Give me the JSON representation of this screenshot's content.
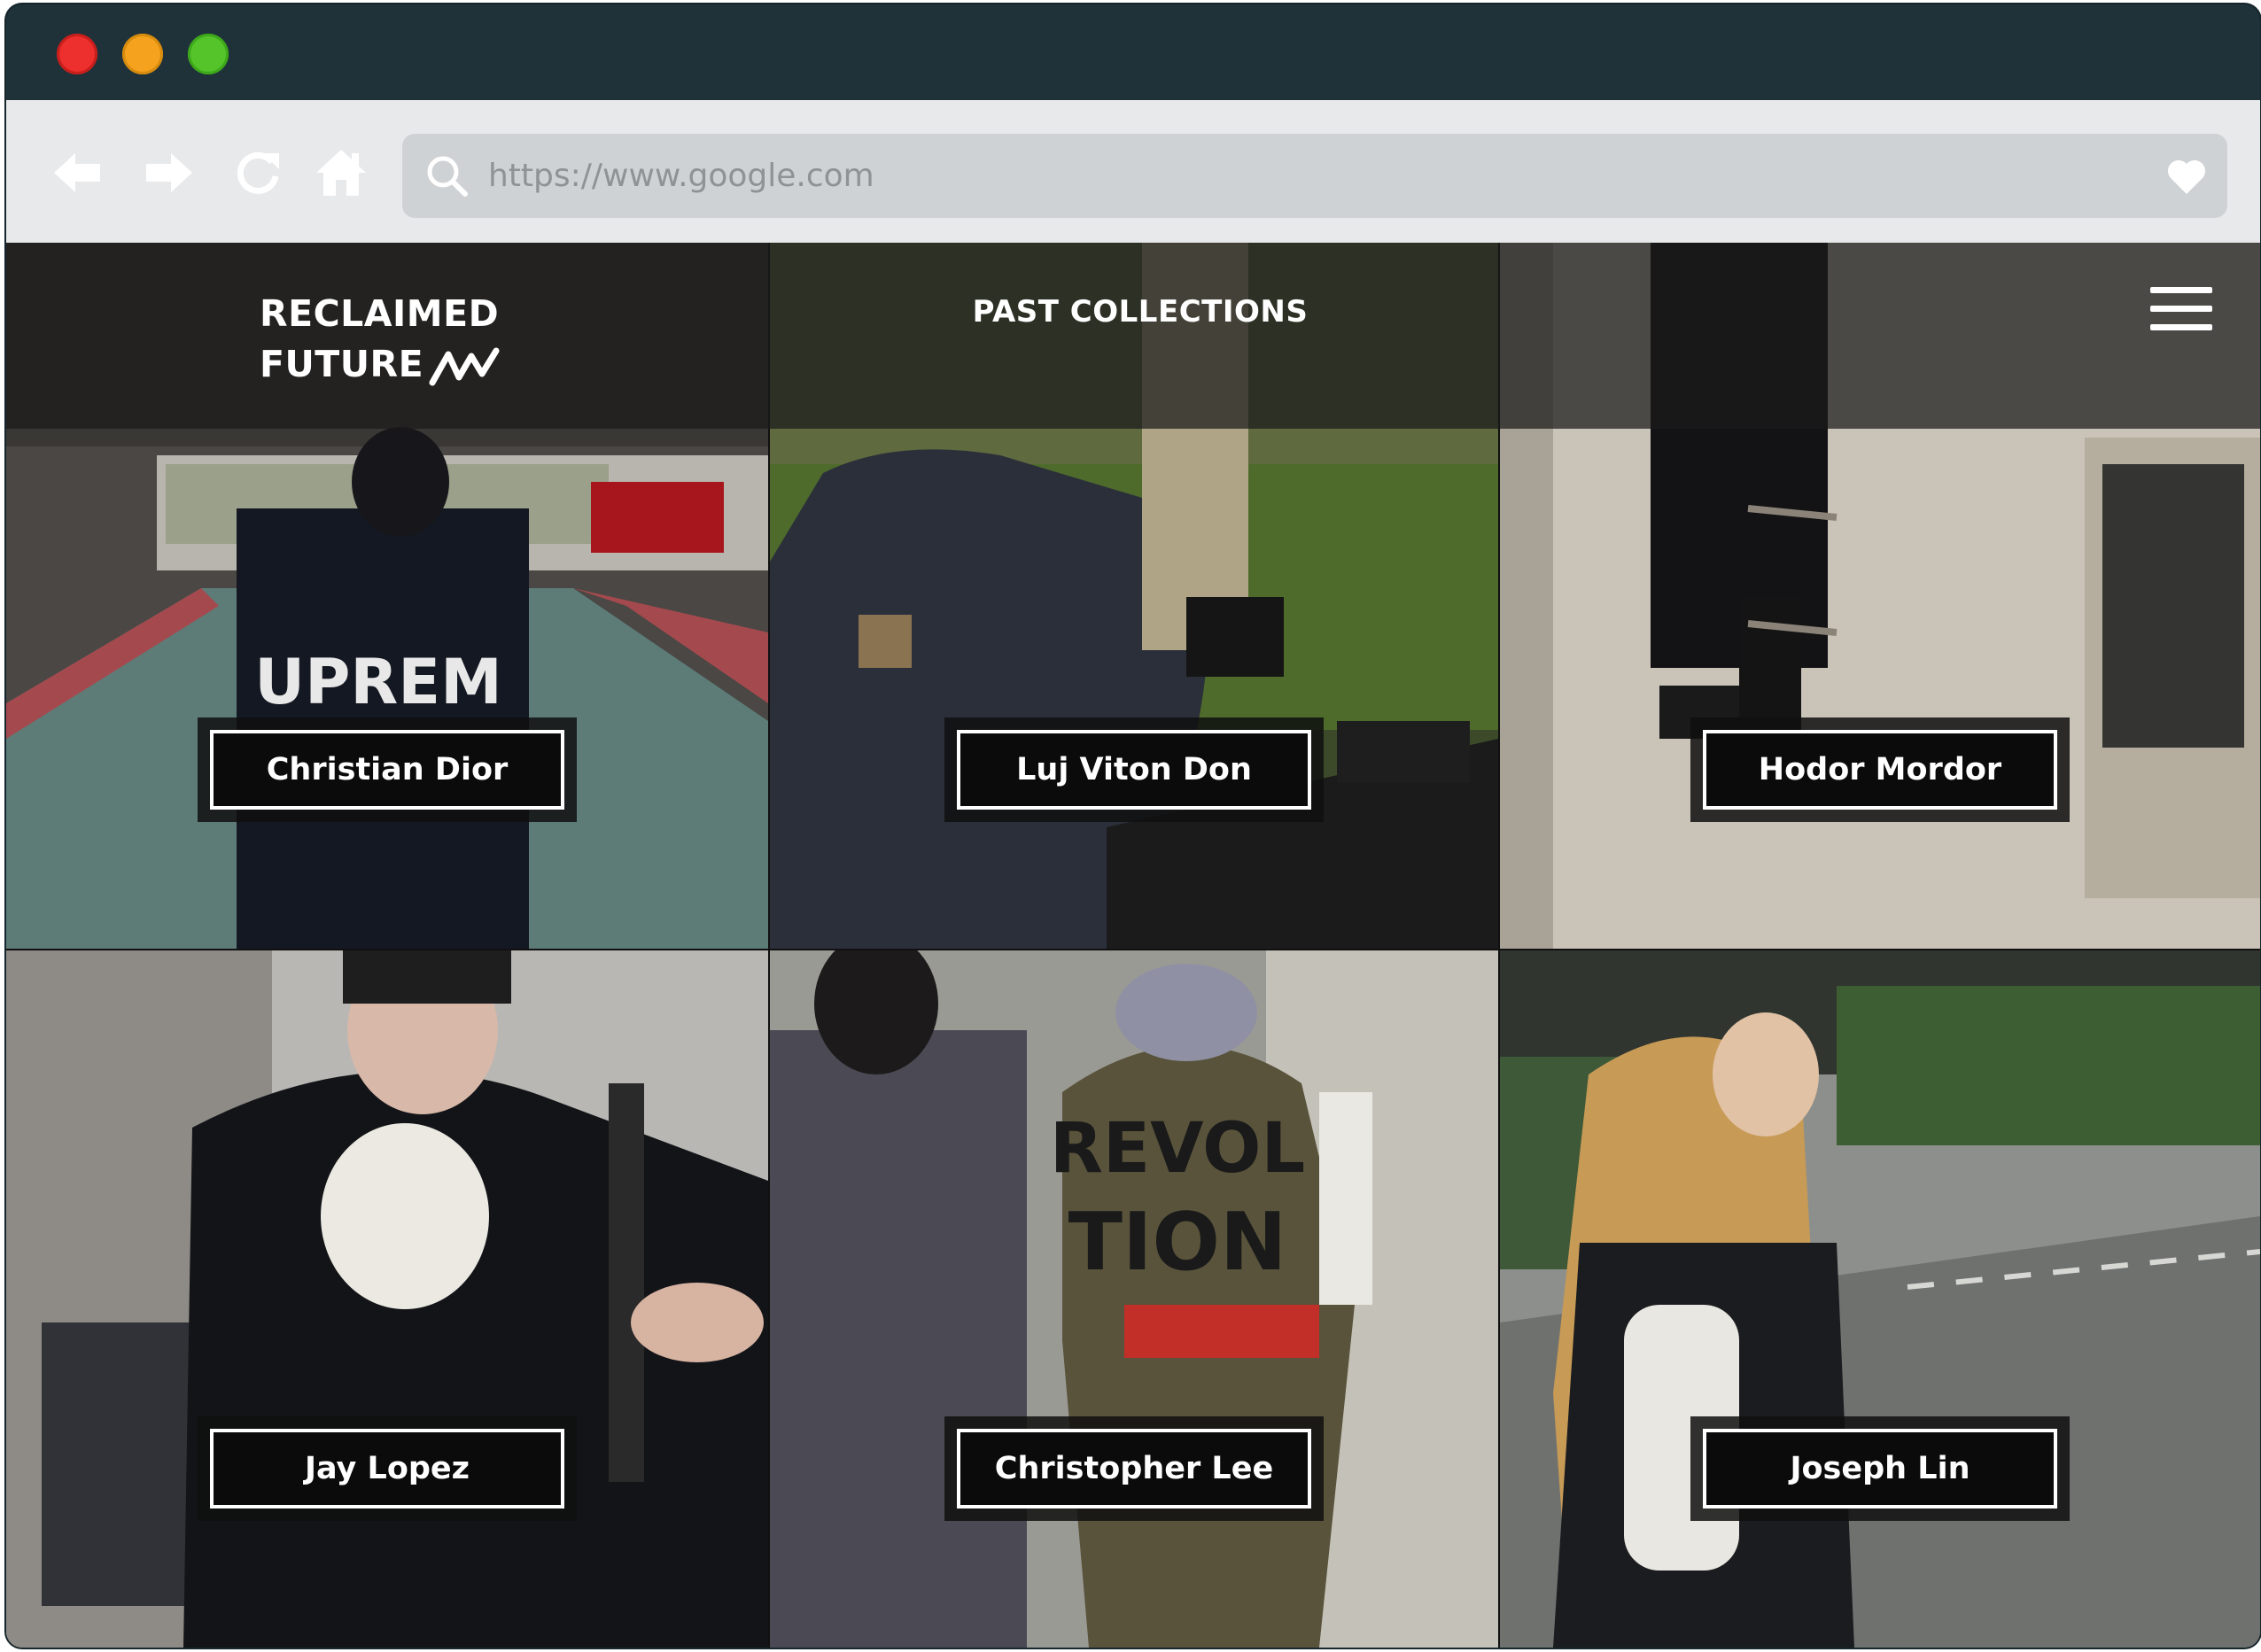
{
  "browser": {
    "url": "https://www.google.com",
    "controls": [
      "close",
      "minimize",
      "maximize"
    ],
    "nav_icons": [
      "back-arrow-icon",
      "forward-arrow-icon",
      "reload-icon",
      "home-icon"
    ],
    "colors": {
      "titlebar": "#1f3239",
      "toolbar": "#e8e9ea",
      "urlbar": "#cfd2d4",
      "red": "#ed2f2d",
      "yellow": "#f5a21e",
      "green": "#55c42b"
    }
  },
  "site": {
    "logo_line1": "RECLAIMED",
    "logo_line2": "FUTURE",
    "title": "PAST COLLECTIONS",
    "menu_icon": "hamburger-menu-icon"
  },
  "collections": [
    {
      "name": "Christian Dior"
    },
    {
      "name": "Luj Viton Don"
    },
    {
      "name": "Hodor Mordor"
    },
    {
      "name": "Jay Lopez"
    },
    {
      "name": "Christopher Lee"
    },
    {
      "name": "Joseph Lin"
    }
  ]
}
